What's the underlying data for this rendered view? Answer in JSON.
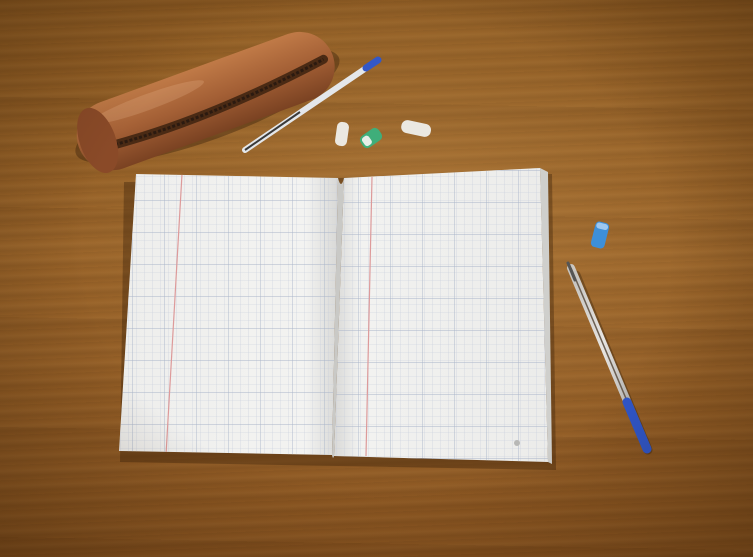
{
  "scene": {
    "description_items": [
      "open-notebook",
      "pencil-case",
      "ballpoint-pen",
      "erasers"
    ],
    "colors": {
      "desk": "#8f5c23",
      "paper": "#f2f2f0",
      "grid_line": "#b9c3d6",
      "margin_line": "#d99a9a",
      "leather": "#a9643a",
      "pen_blue": "#2f56c9",
      "eraser_green": "#3fae7a",
      "eraser_blue": "#3d8fd8",
      "eraser_white": "#e9e6df"
    },
    "icons": [
      "notebook-icon",
      "pencil-case-icon",
      "pen-icon",
      "eraser-icon"
    ]
  }
}
